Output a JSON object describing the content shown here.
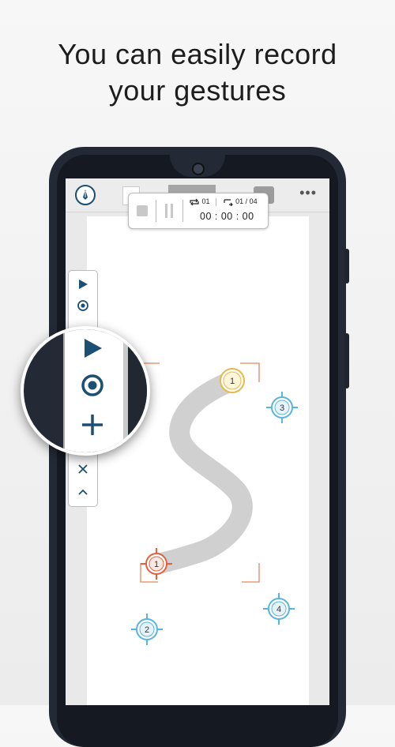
{
  "headline": {
    "line1": "You can easily record",
    "line2": "your gestures"
  },
  "topbar": {
    "pen_icon": "pen-icon",
    "menu_label": "•••"
  },
  "recorder": {
    "stop_icon": "stop-icon",
    "pause_icon": "pause-icon",
    "repeat_icon": "repeat-icon",
    "repeat_count": "01",
    "step_icon": "step-icon",
    "step_count": "01 / 04",
    "timer": "00 : 00 : 00"
  },
  "toolbar": {
    "items": [
      {
        "icon": "play-icon",
        "glyph": "▶"
      },
      {
        "icon": "target-icon",
        "glyph": "◉"
      },
      {
        "icon": "target-icon",
        "glyph": "◉"
      },
      {
        "icon": "close-icon",
        "glyph": "✕"
      },
      {
        "icon": "chevron-up-icon",
        "glyph": "⌃"
      }
    ]
  },
  "magnifier": {
    "items": [
      {
        "icon": "play-icon"
      },
      {
        "icon": "target-icon"
      },
      {
        "icon": "plus-icon"
      }
    ]
  },
  "targets": [
    {
      "label": "1",
      "kind": "swipe-end",
      "color": "#e8b84a"
    },
    {
      "label": "1",
      "kind": "swipe-start",
      "color": "#e5603c"
    },
    {
      "label": "2",
      "kind": "tap",
      "color": "#5ab4e2"
    },
    {
      "label": "3",
      "kind": "tap",
      "color": "#5ab4e2"
    },
    {
      "label": "4",
      "kind": "tap",
      "color": "#5ab4e2"
    }
  ],
  "colors": {
    "accent": "#1c4f74",
    "path": "#d0d0d0",
    "selection_bracket": "#e8865e"
  }
}
